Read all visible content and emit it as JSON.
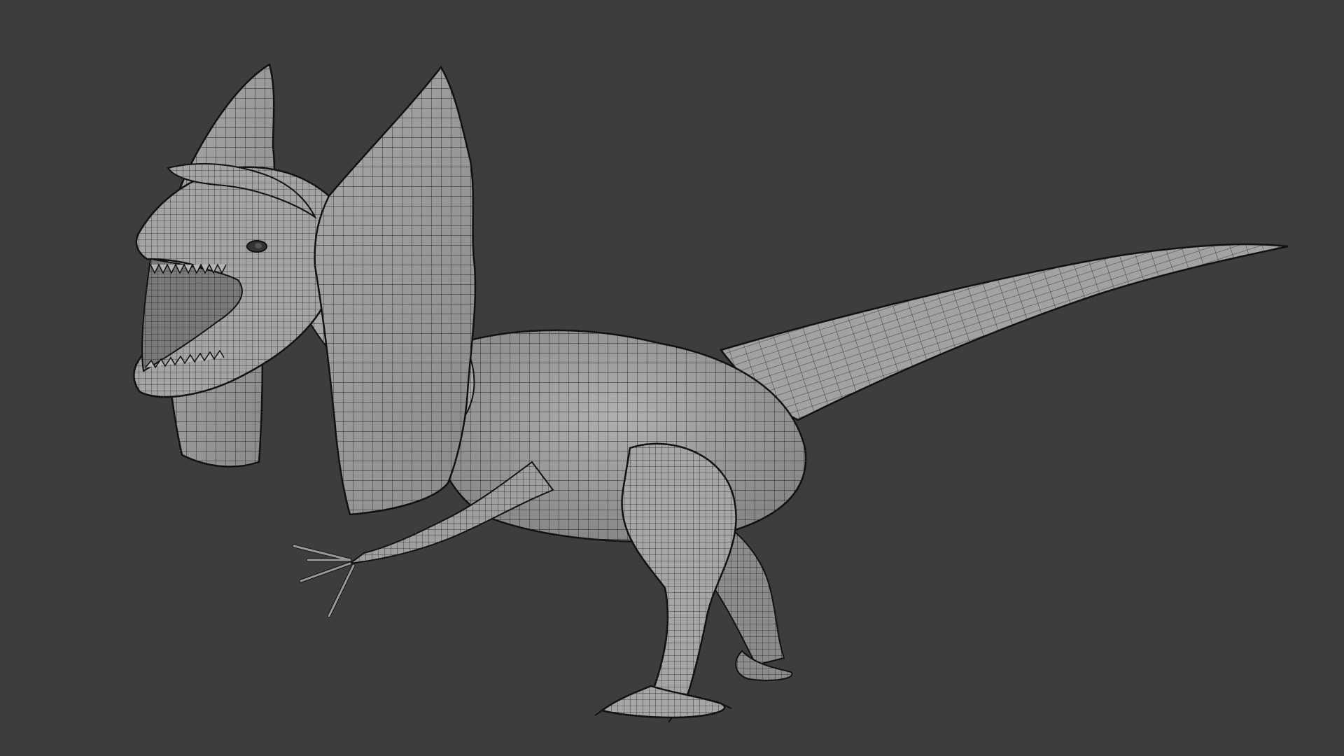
{
  "viewport": {
    "background": "#3d3d3d",
    "mode": "3d-viewport-wireframe-overlay"
  },
  "model": {
    "subject": "dilophosaurus",
    "surface_color": "#9c9c9c",
    "wire_color": "#1a1a1a",
    "parts": [
      "frill-left",
      "frill-right",
      "head",
      "jaw",
      "teeth",
      "eye",
      "neck",
      "body",
      "tail",
      "front-arm",
      "rear-leg-near",
      "rear-leg-far",
      "foot-near",
      "foot-far"
    ]
  }
}
